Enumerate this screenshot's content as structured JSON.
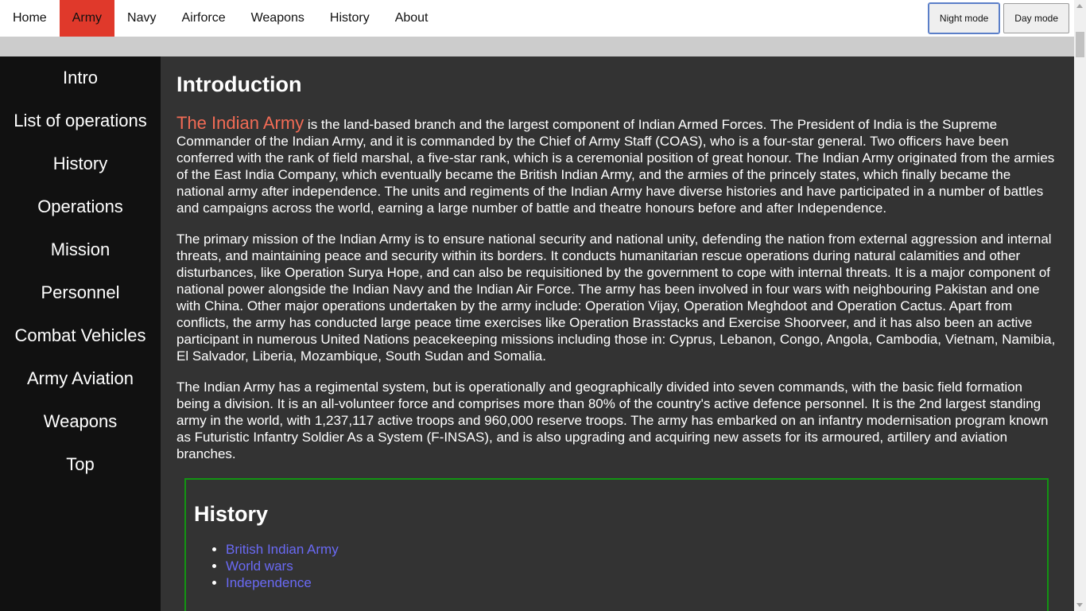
{
  "topnav": {
    "items": [
      {
        "label": "Home"
      },
      {
        "label": "Army"
      },
      {
        "label": "Navy"
      },
      {
        "label": "Airforce"
      },
      {
        "label": "Weapons"
      },
      {
        "label": "History"
      },
      {
        "label": "About"
      }
    ],
    "active": "Army",
    "night_mode_label": "Night mode",
    "day_mode_label": "Day mode"
  },
  "sidebar": {
    "items": [
      {
        "label": "Intro"
      },
      {
        "label": "List of operations"
      },
      {
        "label": "History"
      },
      {
        "label": "Operations"
      },
      {
        "label": "Mission"
      },
      {
        "label": "Personnel"
      },
      {
        "label": "Combat Vehicles"
      },
      {
        "label": "Army Aviation"
      },
      {
        "label": "Weapons"
      },
      {
        "label": "Top"
      }
    ]
  },
  "main": {
    "title": "Introduction",
    "lead_highlight": "The Indian Army",
    "paragraph1_rest": " is the land-based branch and the largest component of Indian Armed Forces. The President of India is the Supreme Commander of the Indian Army, and it is commanded by the Chief of Army Staff (COAS), who is a four-star general. Two officers have been conferred with the rank of field marshal, a five-star rank, which is a ceremonial position of great honour. The Indian Army originated from the armies of the East India Company, which eventually became the British Indian Army, and the armies of the princely states, which finally became the national army after independence. The units and regiments of the Indian Army have diverse histories and have participated in a number of battles and campaigns across the world, earning a large number of battle and theatre honours before and after Independence.",
    "paragraph2": "The primary mission of the Indian Army is to ensure national security and national unity, defending the nation from external aggression and internal threats, and maintaining peace and security within its borders. It conducts humanitarian rescue operations during natural calamities and other disturbances, like Operation Surya Hope, and can also be requisitioned by the government to cope with internal threats. It is a major component of national power alongside the Indian Navy and the Indian Air Force. The army has been involved in four wars with neighbouring Pakistan and one with China. Other major operations undertaken by the army include: Operation Vijay, Operation Meghdoot and Operation Cactus. Apart from conflicts, the army has conducted large peace time exercises like Operation Brasstacks and Exercise Shoorveer, and it has also been an active participant in numerous United Nations peacekeeping missions including those in: Cyprus, Lebanon, Congo, Angola, Cambodia, Vietnam, Namibia, El Salvador, Liberia, Mozambique, South Sudan and Somalia.",
    "paragraph3": "The Indian Army has a regimental system, but is operationally and geographically divided into seven commands, with the basic field formation being a division. It is an all-volunteer force and comprises more than 80% of the country's active defence personnel. It is the 2nd largest standing army in the world, with 1,237,117 active troops and 960,000 reserve troops. The army has embarked on an infantry modernisation program known as Futuristic Infantry Soldier As a System (F-INSAS), and is also upgrading and acquiring new assets for its armoured, artillery and aviation branches.",
    "history": {
      "title": "History",
      "links": [
        {
          "label": "British Indian Army"
        },
        {
          "label": "World wars"
        },
        {
          "label": "Independence"
        }
      ]
    }
  },
  "colors": {
    "active_nav": "#e0392b",
    "highlight": "#f26b55",
    "link": "#6a6af5",
    "history_border": "#129412",
    "sidebar_bg": "#111111",
    "main_bg": "#333333"
  }
}
